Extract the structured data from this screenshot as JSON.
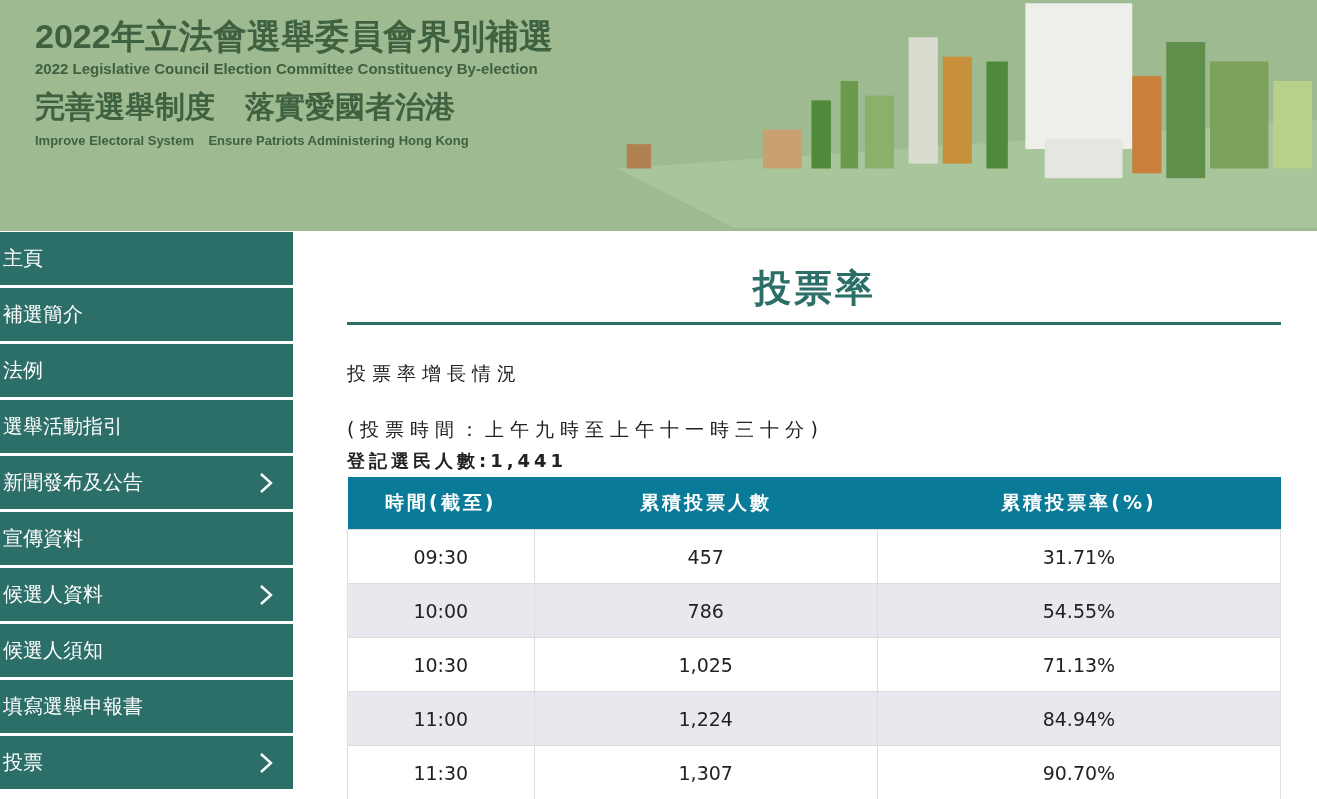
{
  "banner": {
    "title": "2022年立法會選舉委員會界別補選",
    "subtitle": "2022 Legislative Council Election Committee Constituency By-election",
    "slogan": "完善選舉制度　落實愛國者治港",
    "slogan_en": "Improve Electoral System    Ensure Patriots Administering Hong Kong"
  },
  "sidebar": {
    "items": [
      {
        "label": "主頁",
        "has_submenu": false
      },
      {
        "label": "補選簡介",
        "has_submenu": false
      },
      {
        "label": "法例",
        "has_submenu": false
      },
      {
        "label": "選舉活動指引",
        "has_submenu": false
      },
      {
        "label": "新聞發布及公告",
        "has_submenu": true
      },
      {
        "label": "宣傳資料",
        "has_submenu": false
      },
      {
        "label": "候選人資料",
        "has_submenu": true
      },
      {
        "label": "候選人須知",
        "has_submenu": false
      },
      {
        "label": "填寫選舉申報書",
        "has_submenu": false
      },
      {
        "label": "投票",
        "has_submenu": true
      }
    ]
  },
  "page": {
    "title": "投票率",
    "section": "投票率增長情況",
    "polling_hours": "(投票時間：上午九時至上午十一時三十分)",
    "registered": "登記選民人數:1,441"
  },
  "table": {
    "columns": [
      "時間(截至)",
      "累積投票人數",
      "累積投票率(%)"
    ],
    "rows": [
      [
        "09:30",
        "457",
        "31.71%"
      ],
      [
        "10:00",
        "786",
        "54.55%"
      ],
      [
        "10:30",
        "1,025",
        "71.13%"
      ],
      [
        "11:00",
        "1,224",
        "84.94%"
      ],
      [
        "11:30",
        "1,307",
        "90.70%"
      ]
    ]
  }
}
